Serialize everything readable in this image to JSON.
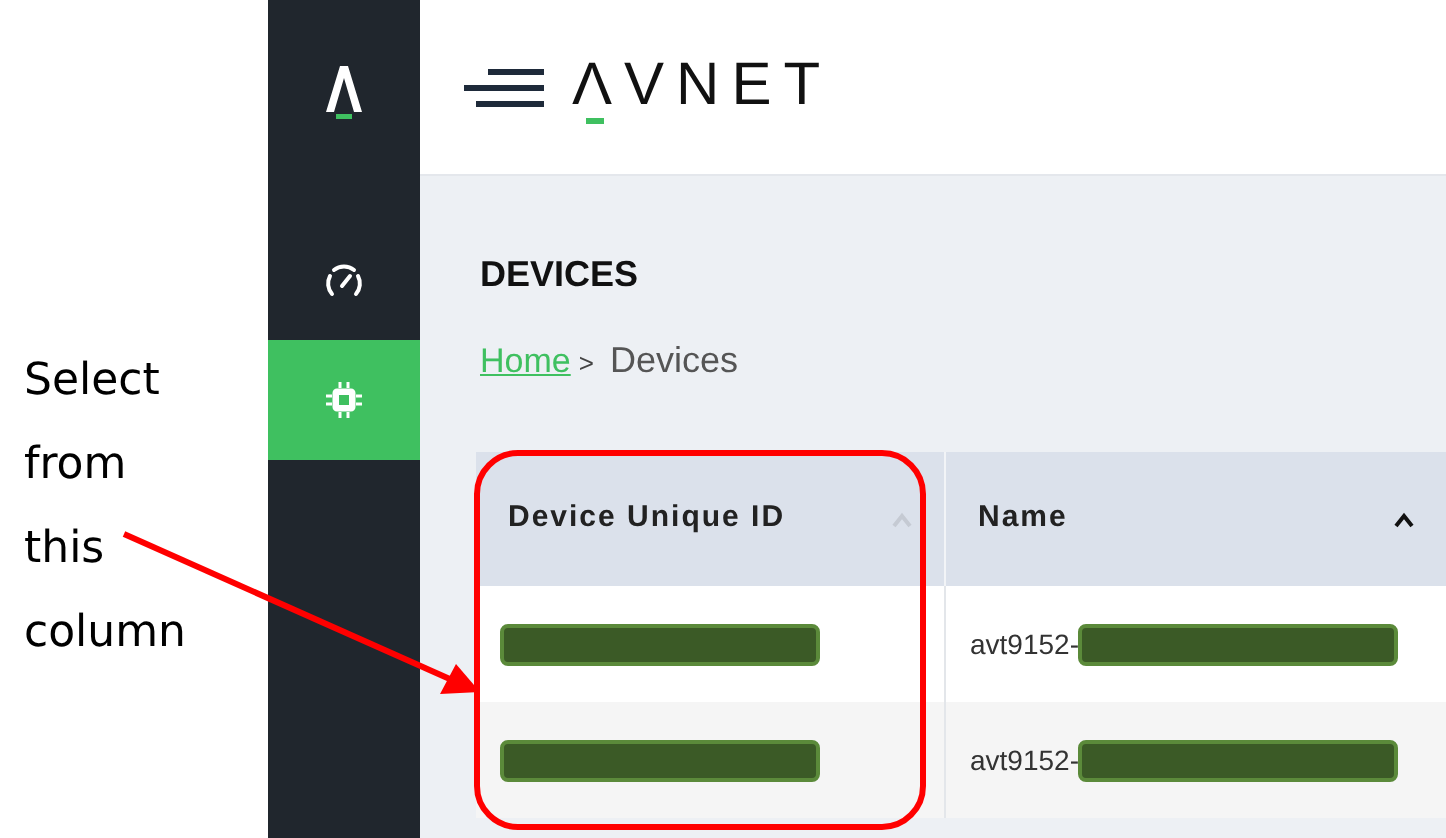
{
  "annotation": {
    "lines": [
      "Select",
      "from",
      "this",
      "column"
    ]
  },
  "header": {
    "logo": "ΛVNET"
  },
  "sidebar": {
    "items": [
      {
        "kind": "gauge",
        "selected": false
      },
      {
        "kind": "chip",
        "selected": true
      }
    ]
  },
  "page": {
    "title": "DEVICES",
    "breadcrumb": {
      "link": "Home",
      "separator": ">",
      "current": "Devices"
    }
  },
  "table": {
    "columns": [
      {
        "label": "Device Unique ID",
        "sort_active": false
      },
      {
        "label": "Name",
        "sort_active": true
      }
    ],
    "rows": [
      [
        {
          "text": "",
          "redacted": true
        },
        {
          "text": "avt9152-",
          "redacted": true
        }
      ],
      [
        {
          "text": "",
          "redacted": true
        },
        {
          "text": "avt9152-",
          "redacted": true
        }
      ]
    ]
  }
}
